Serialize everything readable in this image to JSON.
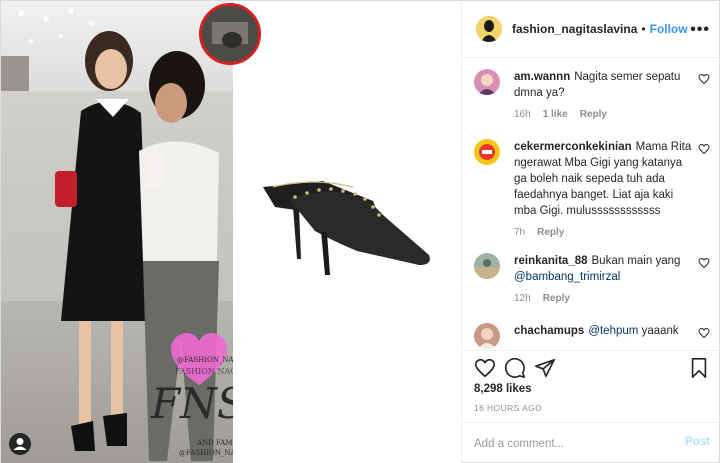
{
  "post": {
    "header": {
      "username": "fashion_nagitaslavina",
      "separator": "•",
      "follow_label": "Follow",
      "more_label": "•••"
    },
    "media": {
      "watermark_top": "@FASHION_NAGITASLAVINA",
      "watermark_line2": "FASHION NAGITA SLAVINA",
      "watermark_big": "FNS",
      "watermark_and_family": "AND FAMILY",
      "watermark_bottom": "@FASHION_NAGITASLAVINA"
    },
    "comments": [
      {
        "username": "am.wannn",
        "text": "Nagita semer sepatu dmna ya?",
        "age": "16h",
        "likes": "1 like",
        "reply_label": "Reply",
        "avatar_color": "#d98fb5"
      },
      {
        "username": "cekermerconkekinian",
        "text": "Mama Rita ngerawat Mba Gigi yang katanya ga boleh naik sepeda tuh ada faedahnya banget. Liat aja kaki mba Gigi. mulussssssssssss",
        "age": "7h",
        "likes": "",
        "reply_label": "Reply",
        "avatar_color": "#f5c51a"
      },
      {
        "username": "reinkanita_88",
        "text": "Bukan main yang",
        "mention": "@bambang_trimirzal",
        "age": "12h",
        "likes": "",
        "reply_label": "Reply",
        "avatar_color": "#9fb3a4"
      },
      {
        "username": "chachamups",
        "mention": "@tehpum",
        "text_after": "yaaank",
        "avatar_color": "#c79a86"
      }
    ],
    "likes_text": "8,298 likes",
    "time_text": "16 HOURS AGO",
    "add_comment_placeholder": "Add a comment...",
    "post_label": "Post",
    "colors": {
      "accent": "#3897f0",
      "inset_ring": "#d32020",
      "watermark_heart": "#f06ad2"
    }
  }
}
